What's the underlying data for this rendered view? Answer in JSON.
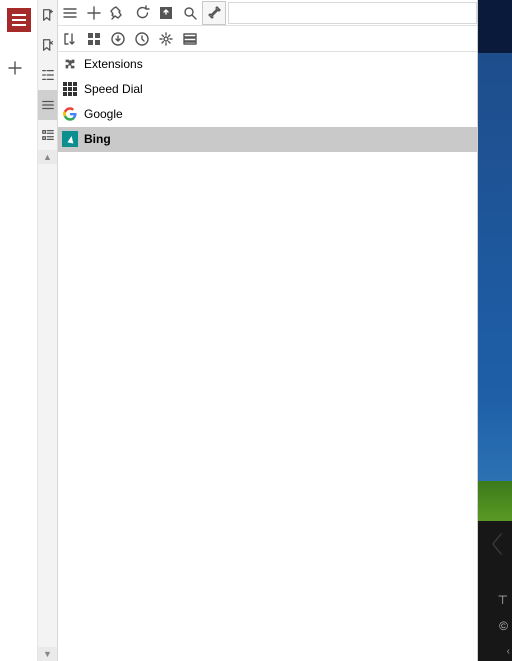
{
  "rail": {
    "menu_title": "Main menu",
    "new_tab_title": "New tab"
  },
  "strip": {
    "items": [
      {
        "name": "add-bookmark",
        "title": "Add bookmark"
      },
      {
        "name": "remove-bookmark",
        "title": "Remove"
      },
      {
        "name": "tree-view",
        "title": "Tree"
      },
      {
        "name": "list-view",
        "title": "List",
        "active": true
      },
      {
        "name": "details-view",
        "title": "Details"
      }
    ],
    "scroll_up_title": "Scroll up",
    "scroll_down_title": "Scroll down"
  },
  "toolbar1": {
    "items": [
      {
        "name": "view-button",
        "title": "View"
      },
      {
        "name": "add-button",
        "title": "Add"
      },
      {
        "name": "pin-button",
        "title": "Pin"
      },
      {
        "name": "reload-button",
        "title": "Reload"
      },
      {
        "name": "import-button",
        "title": "Import"
      },
      {
        "name": "search-button",
        "title": "Search"
      },
      {
        "name": "settings-button",
        "title": "Settings"
      }
    ],
    "search_placeholder": ""
  },
  "toolbar2": {
    "items": [
      {
        "name": "sort-button",
        "title": "Sort"
      },
      {
        "name": "layout-button",
        "title": "Layout"
      },
      {
        "name": "downloads-button",
        "title": "Downloads"
      },
      {
        "name": "history-button",
        "title": "History"
      },
      {
        "name": "manage-button",
        "title": "Manage"
      },
      {
        "name": "rows-button",
        "title": "Rows"
      }
    ]
  },
  "bookmarks": {
    "items": [
      {
        "id": "extensions",
        "label": "Extensions",
        "icon": "puzzle",
        "selected": false
      },
      {
        "id": "speed-dial",
        "label": "Speed Dial",
        "icon": "grid",
        "selected": false
      },
      {
        "id": "google",
        "label": "Google",
        "icon": "google",
        "selected": false
      },
      {
        "id": "bing",
        "label": "Bing",
        "icon": "bing",
        "selected": true
      }
    ]
  },
  "sliver": {
    "copyright": "©",
    "top_symbol": "⊤"
  }
}
